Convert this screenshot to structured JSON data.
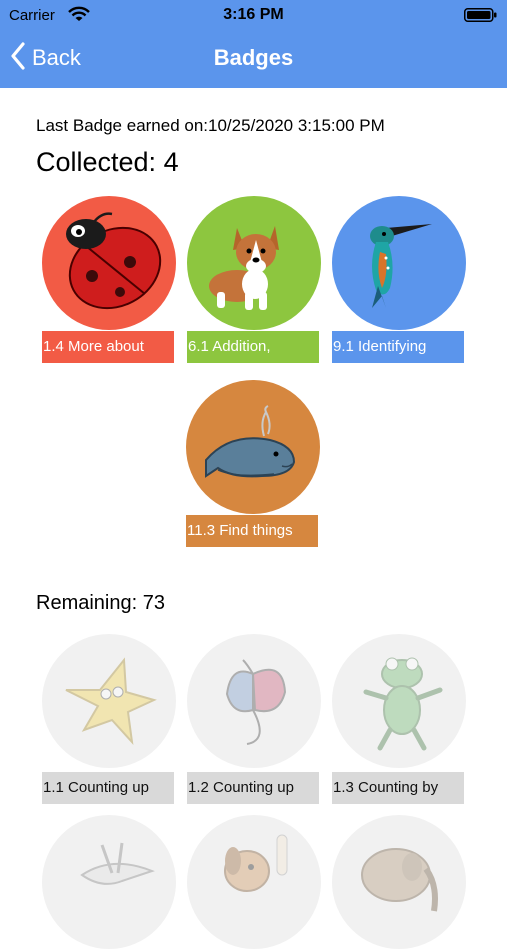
{
  "status_bar": {
    "carrier": "Carrier",
    "time": "3:16 PM",
    "wifi_icon": "wifi-icon",
    "battery_icon": "battery-icon"
  },
  "nav": {
    "back_label": "Back",
    "title": "Badges",
    "back_icon": "chevron-left-icon",
    "background": "#5b95ec"
  },
  "last_badge_text": "Last Badge earned on:10/25/2020 3:15:00 PM",
  "collected": {
    "title": "Collected: 4",
    "badges": [
      {
        "label": "1.4 More about",
        "color": "#f25b45",
        "icon": "ladybug-icon"
      },
      {
        "label": "6.1 Addition,",
        "color": "#8dc63f",
        "icon": "corgi-dog-icon"
      },
      {
        "label": "9.1 Identifying",
        "color": "#5b95ec",
        "icon": "kingfisher-bird-icon"
      },
      {
        "label": "11.3 Find things",
        "color": "#d6873f",
        "icon": "whale-icon"
      }
    ]
  },
  "remaining": {
    "title": "Remaining: 73",
    "badges": [
      {
        "label": "1.1 Counting up",
        "icon": "star-icon"
      },
      {
        "label": "1.2 Counting up",
        "icon": "butterfly-icon"
      },
      {
        "label": "1.3 Counting by",
        "icon": "frog-icon"
      },
      {
        "label": "",
        "icon": "bird-icon"
      },
      {
        "label": "",
        "icon": "dog-icon"
      },
      {
        "label": "",
        "icon": "elephant-icon"
      }
    ]
  }
}
